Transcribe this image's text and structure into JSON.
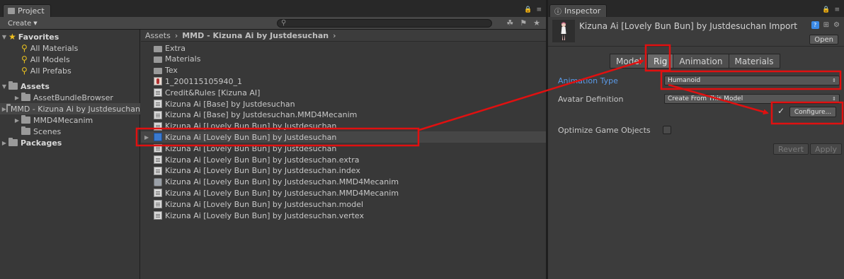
{
  "project": {
    "tab_label": "Project",
    "create_label": "Create",
    "tree": [
      {
        "label": "Favorites",
        "bold": true,
        "kind": "star",
        "depth": 0
      },
      {
        "label": "All Materials",
        "kind": "search",
        "depth": 1
      },
      {
        "label": "All Models",
        "kind": "search",
        "depth": 1
      },
      {
        "label": "All Prefabs",
        "kind": "search",
        "depth": 1
      },
      {
        "label": "Assets",
        "bold": true,
        "kind": "folder",
        "depth": 0
      },
      {
        "label": "AssetBundleBrowser",
        "kind": "folder",
        "depth": 1
      },
      {
        "label": "MMD - Kizuna Ai by Justdesuchan",
        "kind": "folder",
        "depth": 1,
        "selected": true
      },
      {
        "label": "MMD4Mecanim",
        "kind": "folder",
        "depth": 1
      },
      {
        "label": "Scenes",
        "kind": "folder",
        "depth": 1
      },
      {
        "label": "Packages",
        "bold": true,
        "kind": "folder",
        "depth": 0
      }
    ],
    "breadcrumb": [
      "Assets",
      "MMD - Kizuna Ai by Justdesuchan"
    ],
    "files": [
      {
        "label": "Extra",
        "icon": "folder"
      },
      {
        "label": "Materials",
        "icon": "folder"
      },
      {
        "label": "Tex",
        "icon": "folder"
      },
      {
        "label": "1_200115105940_1",
        "icon": "image"
      },
      {
        "label": "Credit&Rules [Kizuna AI]",
        "icon": "doc"
      },
      {
        "label": "Kizuna Ai [Base] by Justdesuchan",
        "icon": "doc"
      },
      {
        "label": "Kizuna Ai [Base] by Justdesuchan.MMD4Mecanim",
        "icon": "doc"
      },
      {
        "label": "Kizuna Ai [Lovely Bun Bun] by Justdesuchan",
        "icon": "doc"
      },
      {
        "label": "Kizuna Ai [Lovely Bun Bun] by Justdesuchan",
        "icon": "prefab",
        "selected": true
      },
      {
        "label": "Kizuna Ai [Lovely Bun Bun] by Justdesuchan",
        "icon": "doc"
      },
      {
        "label": "Kizuna Ai [Lovely Bun Bun] by Justdesuchan.extra",
        "icon": "doc"
      },
      {
        "label": "Kizuna Ai [Lovely Bun Bun] by Justdesuchan.index",
        "icon": "doc"
      },
      {
        "label": "Kizuna Ai [Lovely Bun Bun] by Justdesuchan.MMD4Mecanim",
        "icon": "mecanim"
      },
      {
        "label": "Kizuna Ai [Lovely Bun Bun] by Justdesuchan.MMD4Mecanim",
        "icon": "doc"
      },
      {
        "label": "Kizuna Ai [Lovely Bun Bun] by Justdesuchan.model",
        "icon": "doc"
      },
      {
        "label": "Kizuna Ai [Lovely Bun Bun] by Justdesuchan.vertex",
        "icon": "doc"
      }
    ]
  },
  "inspector": {
    "tab_label": "Inspector",
    "title": "Kizuna Ai [Lovely Bun Bun] by Justdesuchan Import",
    "open_label": "Open",
    "tabs": [
      {
        "label": "Model"
      },
      {
        "label": "Rig",
        "active": true
      },
      {
        "label": "Animation"
      },
      {
        "label": "Materials"
      }
    ],
    "animation_type_label": "Animation Type",
    "animation_type_value": "Humanoid",
    "avatar_definition_label": "Avatar Definition",
    "avatar_definition_value": "Create From This Model",
    "configure_label": "Configure...",
    "optimize_label": "Optimize Game Objects",
    "revert_label": "Revert",
    "apply_label": "Apply"
  },
  "colors": {
    "annotation": "#e01010",
    "accent_blue": "#5a9ae8",
    "selection": "#464646"
  }
}
